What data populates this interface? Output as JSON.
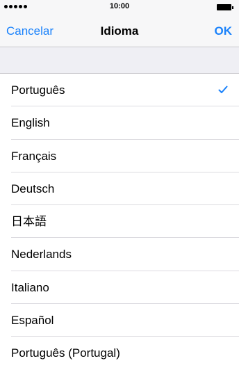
{
  "status_bar": {
    "time": "10:00"
  },
  "nav": {
    "cancel_label": "Cancelar",
    "title": "Idioma",
    "done_label": "OK"
  },
  "languages": [
    {
      "label": "Português",
      "selected": true
    },
    {
      "label": "English",
      "selected": false
    },
    {
      "label": "Français",
      "selected": false
    },
    {
      "label": "Deutsch",
      "selected": false
    },
    {
      "label": "日本語",
      "selected": false
    },
    {
      "label": "Nederlands",
      "selected": false
    },
    {
      "label": "Italiano",
      "selected": false
    },
    {
      "label": "Español",
      "selected": false
    },
    {
      "label": "Português (Portugal)",
      "selected": false
    }
  ],
  "colors": {
    "accent": "#1a82fb",
    "group_background": "#efeff4",
    "separator": "#dcdbe0"
  },
  "icons": {
    "selected_marker": "checkmark-icon",
    "signal": "signal-strength-icon",
    "battery": "battery-icon"
  }
}
